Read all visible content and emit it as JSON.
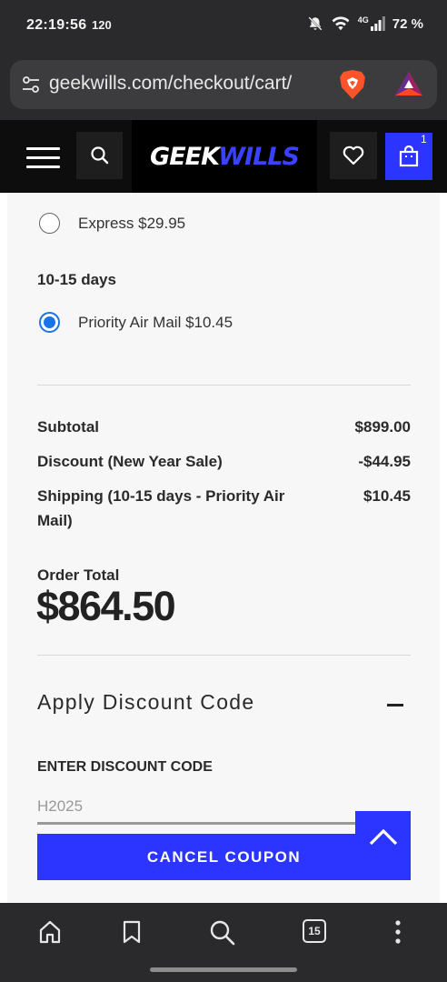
{
  "status_bar": {
    "time": "22:19:56",
    "refresh_rate": "120",
    "network": "4G",
    "battery": "72 %"
  },
  "browser": {
    "url": "geekwills.com/checkout/cart/"
  },
  "site_header": {
    "logo_part1": "GEEK",
    "logo_part2": "WILLS",
    "cart_count": "1"
  },
  "shipping": {
    "express_label": "Express $29.95",
    "group_title": "10-15 days",
    "priority_label": "Priority Air Mail $10.45",
    "selected": "priority"
  },
  "summary": {
    "subtotal_label": "Subtotal",
    "subtotal_value": "$899.00",
    "discount_label": "Discount (New Year Sale)",
    "discount_value": "-$44.95",
    "shipping_label": "Shipping (10-15 days - Priority Air Mail)",
    "shipping_value": "$10.45",
    "order_total_label": "Order Total",
    "order_total_value": "$864.50"
  },
  "discount": {
    "title": "Apply Discount Code",
    "field_label": "ENTER DISCOUNT CODE",
    "code_value": "H2025",
    "cancel_button": "CANCEL COUPON"
  },
  "bottom_nav": {
    "tab_count": "15"
  },
  "colors": {
    "brand_blue": "#2b35ff",
    "radio_blue": "#1a73e8",
    "header_black": "#0d0d0d"
  }
}
